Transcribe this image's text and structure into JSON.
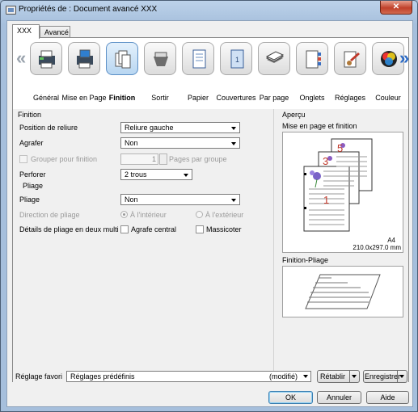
{
  "window": {
    "title": "Propriétés de : Document avancé XXX",
    "close_glyph": "✕"
  },
  "tabs": [
    {
      "label": "XXX",
      "active": true
    },
    {
      "label": "Avancé",
      "active": false
    }
  ],
  "ribbon": {
    "left_arrow": "«",
    "right_arrow": "»",
    "items": [
      {
        "label": "Général",
        "icon": "printer-general-icon"
      },
      {
        "label": "Mise en Page",
        "icon": "page-layout-icon"
      },
      {
        "label": "Finition",
        "icon": "finishing-icon",
        "selected": true
      },
      {
        "label": "Sortir",
        "icon": "output-tray-icon"
      },
      {
        "label": "Papier",
        "icon": "paper-icon"
      },
      {
        "label": "Couvertures",
        "icon": "covers-icon"
      },
      {
        "label": "Par page",
        "icon": "per-page-icon"
      },
      {
        "label": "Onglets",
        "icon": "tabs-icon"
      },
      {
        "label": "Réglages",
        "icon": "settings-icon"
      },
      {
        "label": "Couleur",
        "icon": "color-icon"
      }
    ]
  },
  "finition": {
    "group_title": "Finition",
    "binding_label": "Position de reliure",
    "binding_value": "Reliure gauche",
    "staple_label": "Agrafer",
    "staple_value": "Non",
    "group_finish_label": "Grouper pour finition",
    "pages_per_group_value": "1",
    "pages_per_group_label": "Pages par groupe",
    "punch_label": "Perforer",
    "punch_value": "2 trous"
  },
  "pliage": {
    "group_title": "Pliage",
    "fold_label": "Pliage",
    "fold_value": "Non",
    "direction_label": "Direction de pliage",
    "inside_label": "À l'intérieur",
    "outside_label": "À l'extérieur",
    "details_label": "Détails de pliage en deux multi",
    "center_staple_label": "Agrafe central",
    "trimmer_label": "Massicoter"
  },
  "apercu": {
    "group_title": "Aperçu",
    "layout_label": "Mise en page et finition",
    "paper_name": "A4",
    "paper_size": "210.0x297.0 mm",
    "fold_preview_label": "Finition-Pliage",
    "page_numbers": [
      "5",
      "3",
      "1"
    ],
    "accent_color": "#c0392b"
  },
  "footer": {
    "favorite_label": "Réglage favori",
    "favorite_value": "Réglages prédéfinis",
    "modified_label": "(modifié)",
    "reset_label": "Rétablir",
    "save_label": "Enregistrer",
    "ok_label": "OK",
    "cancel_label": "Annuler",
    "help_label": "Aide"
  }
}
